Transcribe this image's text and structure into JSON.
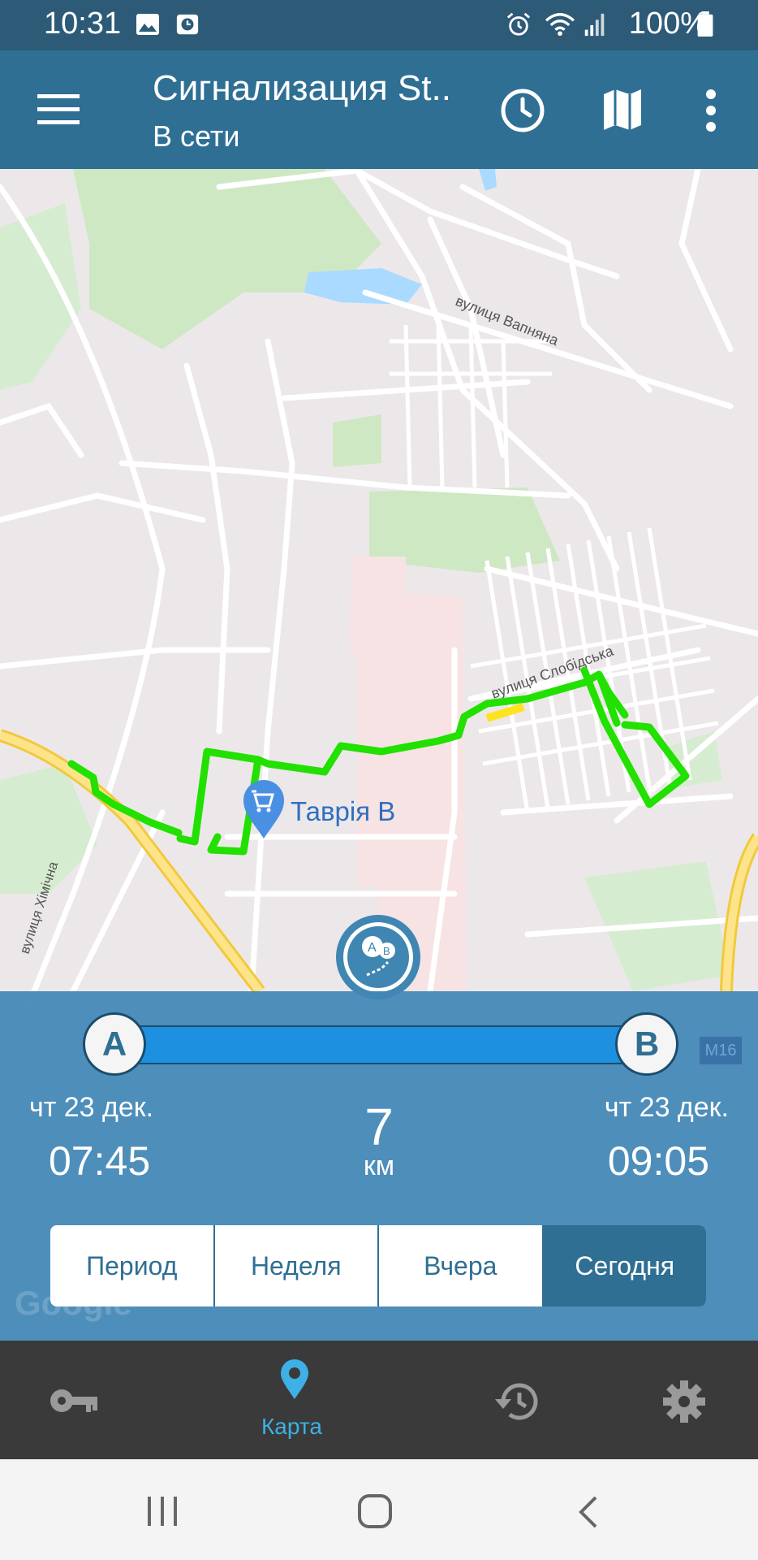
{
  "status_bar": {
    "time": "10:31",
    "battery": "100%"
  },
  "app_bar": {
    "title": "Сигнализация St..",
    "subtitle": "В сети"
  },
  "map": {
    "street_labels": [
      "вулиця Вапняна",
      "вулиця Слобідська",
      "вулиця Хімічна"
    ],
    "place_label": "Таврія В",
    "road_badge": "M16",
    "watermark": "Google"
  },
  "trip": {
    "start_marker": "A",
    "end_marker": "B",
    "start_date": "чт 23 дек.",
    "start_time": "07:45",
    "end_date": "чт 23 дек.",
    "end_time": "09:05",
    "distance": "7",
    "distance_unit": "км"
  },
  "period_tabs": [
    "Период",
    "Неделя",
    "Вчера",
    "Сегодня"
  ],
  "active_tab": "Сегодня",
  "bottom_nav": {
    "map_label": "Карта"
  },
  "colors": {
    "status_bar": "#2c5a77",
    "app_bar": "#2f6f94",
    "panel": "#4287b6",
    "route": "#22e000",
    "accent": "#3db0e6"
  }
}
